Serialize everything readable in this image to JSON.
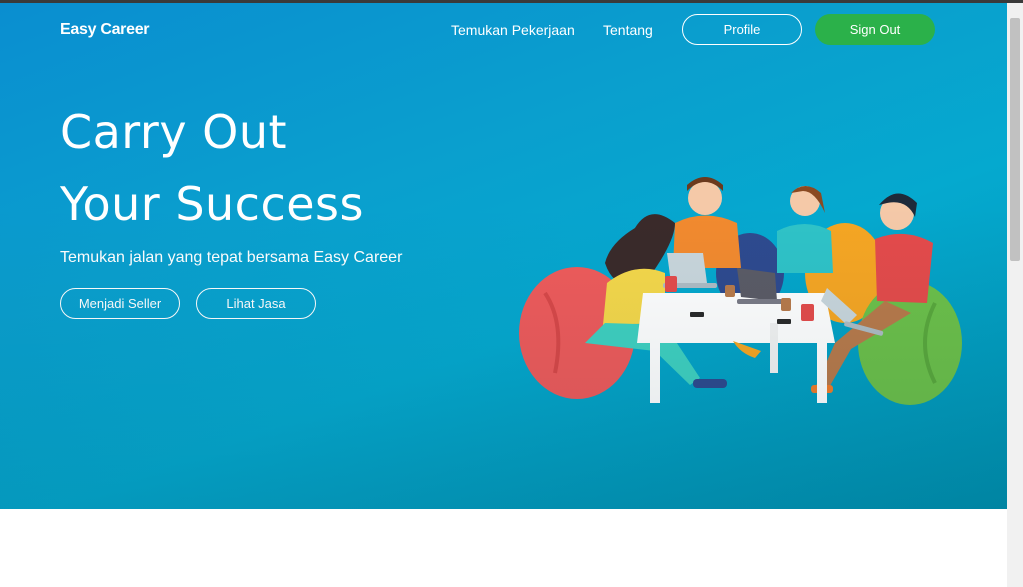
{
  "navbar": {
    "brand": "Easy Career",
    "links": [
      "Temukan Pekerjaan",
      "Tentang"
    ],
    "profile_label": "Profile",
    "signout_label": "Sign Out"
  },
  "hero": {
    "headline_line1": "Carry Out",
    "headline_line2": "Your Success",
    "subtitle": "Temukan jalan yang tepat bersama Easy Career",
    "seller_button": "Menjadi Seller",
    "services_button": "Lihat Jasa"
  },
  "colors": {
    "hero_start": "#0a8ed0",
    "hero_end": "#0091b0",
    "signout": "#2bb14a"
  },
  "icons": {
    "illustration": "team-working-illustration"
  }
}
